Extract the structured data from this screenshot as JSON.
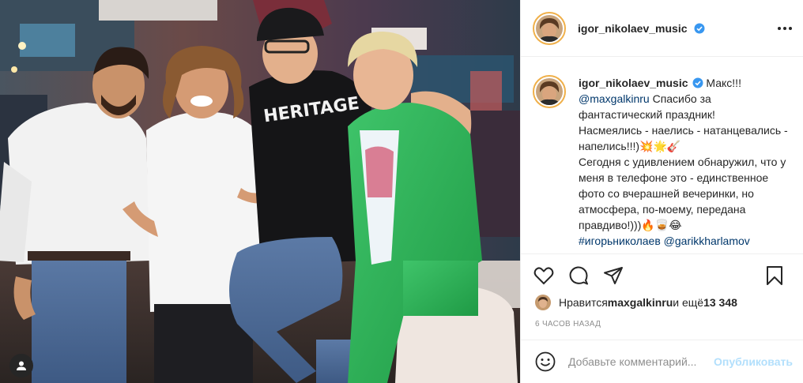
{
  "post": {
    "username": "igor_nikolaev_music",
    "verified": true
  },
  "caption": {
    "username": "igor_nikolaev_music",
    "text_1": " Макс!!!\n",
    "mention_1": "@maxgalkinru",
    "text_2": " Спасибо за фантастический праздник!\nНасмеялись - наелись - натанцевались - напелись!!!)💥🌟🎸\nСегодня с удивлением обнаружил, что у меня в телефоне это - единственное фото со вчерашней вечеринки, но атмосфера, по-моему, передана правдиво!)))🔥🥃😂\n",
    "hashtag": "#игорьниколаев",
    "mention_2": " @garikkharlamov"
  },
  "likes": {
    "prefix": "Нравится ",
    "user": "maxgalkinru",
    "middle": " и ещё ",
    "count": "13 348"
  },
  "time": "6 часов назад",
  "comment": {
    "placeholder": "Добавьте комментарий...",
    "post_label": "Опубликовать"
  },
  "icons": {
    "like": "heart-icon",
    "comment": "comment-icon",
    "share": "share-icon",
    "save": "bookmark-icon",
    "more": "more-icon",
    "emoji": "emoji-icon",
    "user_tag": "user-tag-icon",
    "verified": "verified-badge-icon"
  },
  "colors": {
    "verified": "#3897f0",
    "link": "#00376b",
    "post_button": "#b2dffc",
    "muted": "#8e8e8e"
  }
}
